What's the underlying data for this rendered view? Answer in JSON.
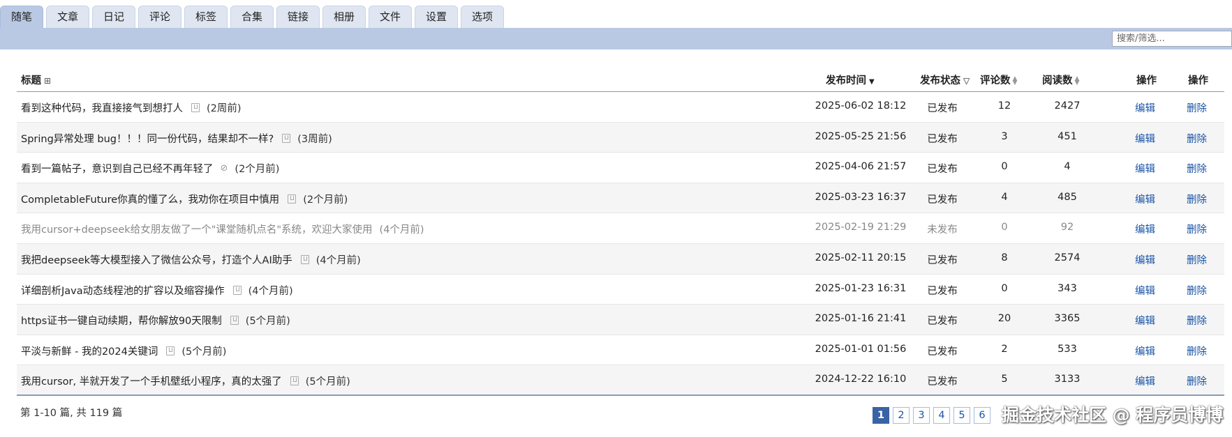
{
  "tabs": [
    "随笔",
    "文章",
    "日记",
    "评论",
    "标签",
    "合集",
    "链接",
    "相册",
    "文件",
    "设置",
    "选项"
  ],
  "search": {
    "placeholder": "搜索/筛选..."
  },
  "table": {
    "headers": {
      "title": "标题",
      "time": "发布时间",
      "status": "发布状态",
      "comments": "评论数",
      "reads": "阅读数",
      "action1": "操作",
      "action2": "操作"
    },
    "rows": [
      {
        "title": "看到这种代码，我直接接气到想打人",
        "ago": "(2周前)",
        "time": "2025-06-02 18:12",
        "status": "已发布",
        "comments": "12",
        "reads": "2427",
        "edit": "编辑",
        "del": "删除",
        "icon": "book",
        "published": true
      },
      {
        "title": "Spring异常处理 bug！！！同一份代码，结果却不一样?",
        "ago": "(3周前)",
        "time": "2025-05-25 21:56",
        "status": "已发布",
        "comments": "3",
        "reads": "451",
        "edit": "编辑",
        "del": "删除",
        "icon": "book",
        "published": true
      },
      {
        "title": "看到一篇帖子，意识到自己已经不再年轻了",
        "ago": "(2个月前)",
        "time": "2025-04-06 21:57",
        "status": "已发布",
        "comments": "0",
        "reads": "4",
        "edit": "编辑",
        "del": "删除",
        "icon": "eye-off",
        "published": true
      },
      {
        "title": "CompletableFuture你真的懂了么，我劝你在项目中慎用",
        "ago": "(2个月前)",
        "time": "2025-03-23 16:37",
        "status": "已发布",
        "comments": "4",
        "reads": "485",
        "edit": "编辑",
        "del": "删除",
        "icon": "book",
        "published": true
      },
      {
        "title": "我用cursor+deepseek给女朋友做了一个\"课堂随机点名\"系统，欢迎大家使用",
        "ago": "(4个月前)",
        "time": "2025-02-19 21:29",
        "status": "未发布",
        "comments": "0",
        "reads": "92",
        "edit": "编辑",
        "del": "删除",
        "icon": "",
        "published": false
      },
      {
        "title": "我把deepseek等大模型接入了微信公众号，打造个人AI助手",
        "ago": "(4个月前)",
        "time": "2025-02-11 20:15",
        "status": "已发布",
        "comments": "8",
        "reads": "2574",
        "edit": "编辑",
        "del": "删除",
        "icon": "book",
        "published": true
      },
      {
        "title": "详细剖析Java动态线程池的扩容以及缩容操作",
        "ago": "(4个月前)",
        "time": "2025-01-23 16:31",
        "status": "已发布",
        "comments": "0",
        "reads": "343",
        "edit": "编辑",
        "del": "删除",
        "icon": "book",
        "published": true
      },
      {
        "title": "https证书一键自动续期，帮你解放90天限制",
        "ago": "(5个月前)",
        "time": "2025-01-16 21:41",
        "status": "已发布",
        "comments": "20",
        "reads": "3365",
        "edit": "编辑",
        "del": "删除",
        "icon": "book",
        "published": true
      },
      {
        "title": "平淡与新鲜 - 我的2024关键词",
        "ago": "(5个月前)",
        "time": "2025-01-01 01:56",
        "status": "已发布",
        "comments": "2",
        "reads": "533",
        "edit": "编辑",
        "del": "删除",
        "icon": "book",
        "published": true
      },
      {
        "title": "我用cursor, 半就开发了一个手机壁纸小程序，真的太强了",
        "ago": "(5个月前)",
        "time": "2024-12-22 16:10",
        "status": "已发布",
        "comments": "5",
        "reads": "3133",
        "edit": "编辑",
        "del": "删除",
        "icon": "book",
        "published": true
      }
    ]
  },
  "footer": {
    "page_info": "第 1-10 篇, 共 119 篇",
    "pages": [
      "1",
      "2",
      "3",
      "4",
      "5",
      "6"
    ],
    "current_page": "1",
    "watermark": "掘金技术社区 @ 程序员博博"
  },
  "colors": {
    "accent": "#b9c9e4",
    "link": "#1a55a8",
    "page_active": "#3a63a6"
  }
}
